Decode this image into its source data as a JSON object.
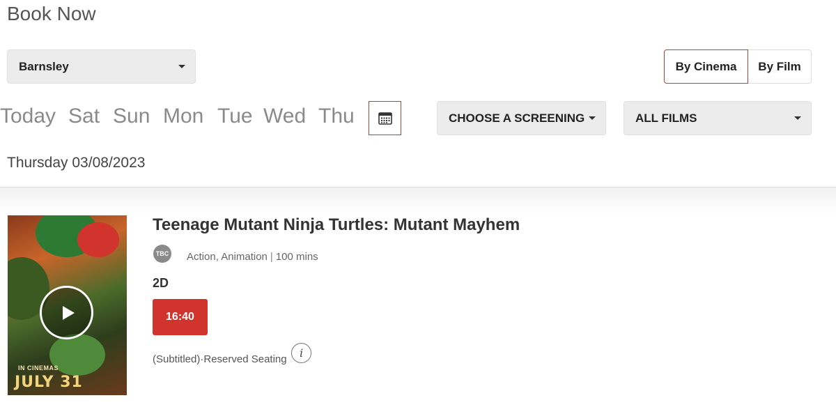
{
  "header": {
    "title": "Book Now"
  },
  "location": {
    "selected": "Barnsley"
  },
  "view_toggle": {
    "by_cinema": "By Cinema",
    "by_film": "By Film",
    "active": "by_cinema"
  },
  "days": [
    "Today",
    "Sat",
    "Sun",
    "Mon",
    "Tue",
    "Wed",
    "Thu"
  ],
  "screening_filter": {
    "selected": "CHOOSE A SCREENING"
  },
  "film_filter": {
    "selected": "ALL FILMS"
  },
  "selected_date": "Thursday 03/08/2023",
  "film": {
    "title": "Teenage Mutant Ninja Turtles: Mutant Mayhem",
    "rating": "TBC",
    "genres": "Action, Animation",
    "separator": "|",
    "duration": "100 mins",
    "format": "2D",
    "showtimes": [
      "16:40"
    ],
    "note": "(Subtitled)·Reserved Seating",
    "poster": {
      "tagline_small": "IN CINEMAS",
      "tagline_big": "JULY 31"
    }
  },
  "colors": {
    "accent": "#d0342c",
    "badge": "#8a8a8a",
    "select_bg": "#ececec"
  },
  "icons": {
    "calendar": "calendar-icon",
    "play": "play-icon",
    "info": "info-icon",
    "caret": "caret-down-icon"
  }
}
